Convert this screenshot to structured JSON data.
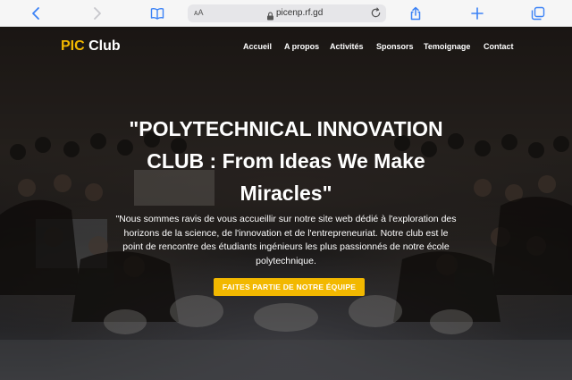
{
  "browser": {
    "text_size_label": "ᴀA",
    "url": "picenp.rf.gd",
    "icons": [
      "back-icon",
      "forward-icon",
      "bookmarks-icon",
      "text-size-icon",
      "lock-icon",
      "reload-icon",
      "share-icon",
      "new-tab-icon",
      "tabs-icon"
    ]
  },
  "site": {
    "logo_pic": "PIC",
    "logo_club": " Club",
    "nav": [
      "Accueil",
      "A propos",
      "Activités",
      "Sponsors",
      "Temoignage",
      "Contact"
    ]
  },
  "hero": {
    "title": "\"POLYTECHNICAL INNOVATION CLUB : From Ideas We Make Miracles\"",
    "description": "\"Nous sommes ravis de vous accueillir sur notre site web dédié à l'exploration des horizons de la science, de l'innovation et de l'entrepreneuriat. Notre club est le point de rencontre des étudiants ingénieurs les plus passionnés de notre école polytechnique.",
    "cta_label": "FAITES PARTIE DE NOTRE ÉQUIPE"
  },
  "colors": {
    "accent": "#f2b800",
    "browser_link": "#3b82f6",
    "overlay": "#000000"
  }
}
